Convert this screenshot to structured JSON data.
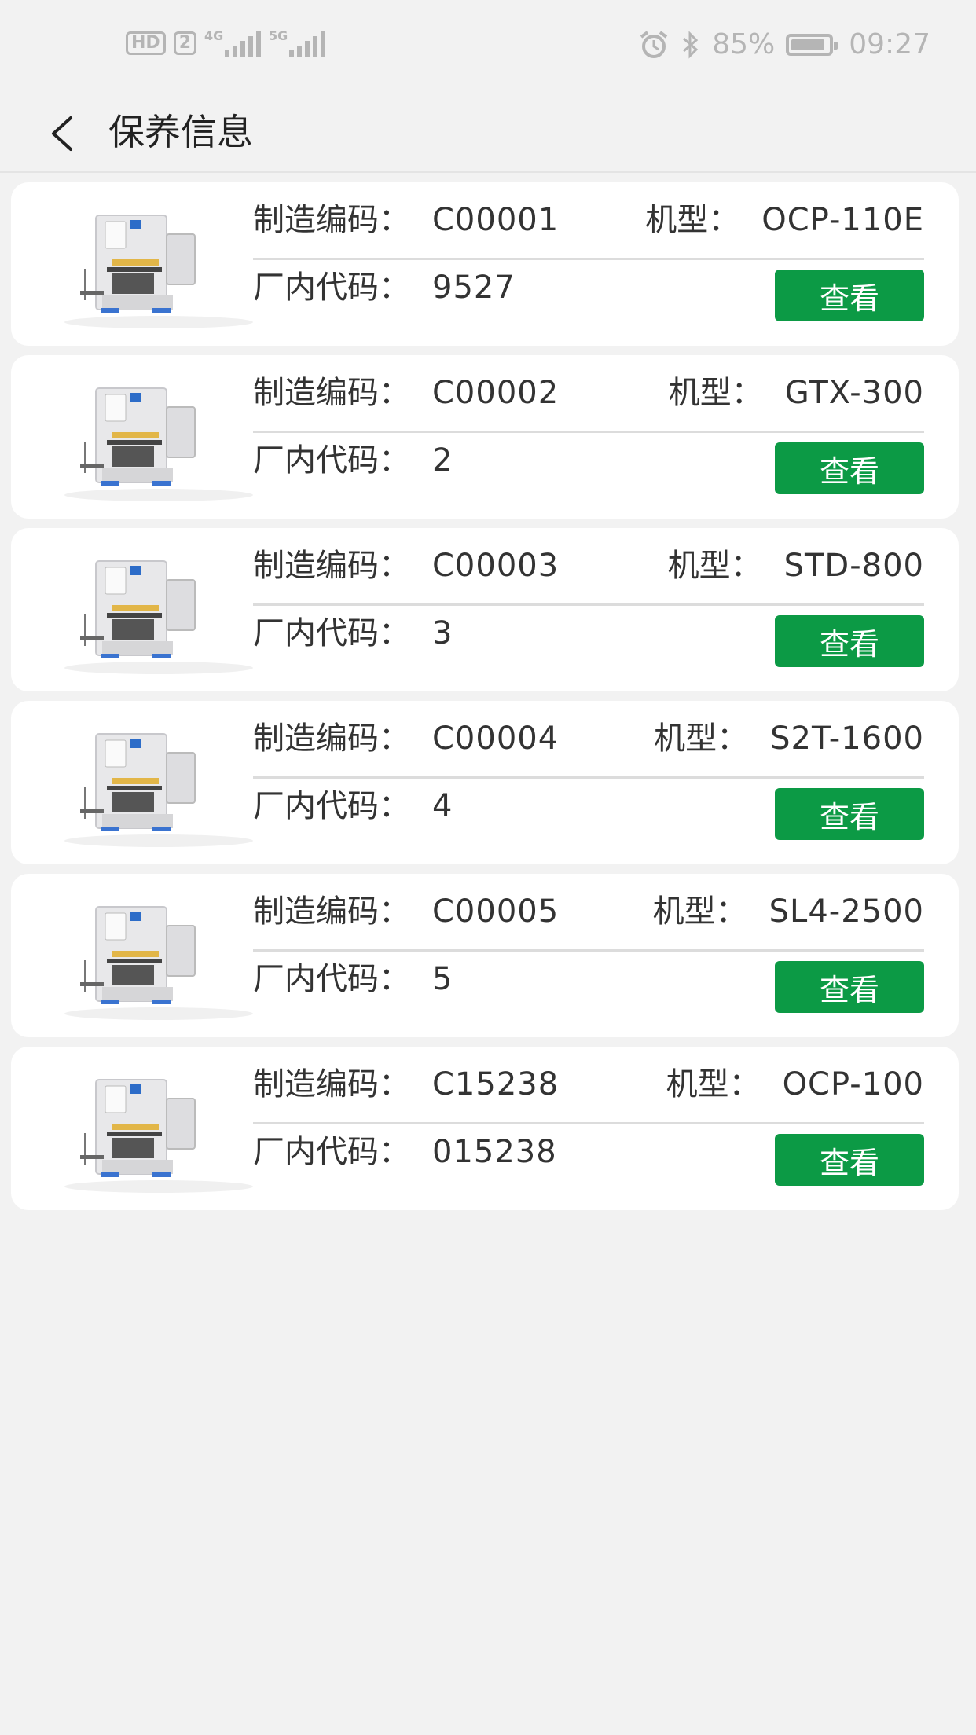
{
  "status_bar": {
    "hd": "HD",
    "sim": "2",
    "net1": "4G",
    "net2": "5G",
    "battery": "85%",
    "battery_level": 0.85,
    "time": "09:27"
  },
  "header": {
    "title": "保养信息",
    "back_icon": "chevron-left-icon"
  },
  "labels": {
    "code": "制造编码：",
    "model": "机型：",
    "factory": "厂内代码：",
    "view": "查看"
  },
  "machines": [
    {
      "code": "C00001",
      "model": "OCP-110E",
      "factory": "9527"
    },
    {
      "code": "C00002",
      "model": "GTX-300",
      "factory": "2"
    },
    {
      "code": "C00003",
      "model": "STD-800",
      "factory": "3"
    },
    {
      "code": "C00004",
      "model": "S2T-1600",
      "factory": "4"
    },
    {
      "code": "C00005",
      "model": "SL4-2500",
      "factory": "5"
    },
    {
      "code": "C15238",
      "model": "OCP-100",
      "factory": "015238"
    }
  ],
  "colors": {
    "accent": "#0c9a45",
    "background": "#f2f2f2",
    "card": "#ffffff"
  }
}
